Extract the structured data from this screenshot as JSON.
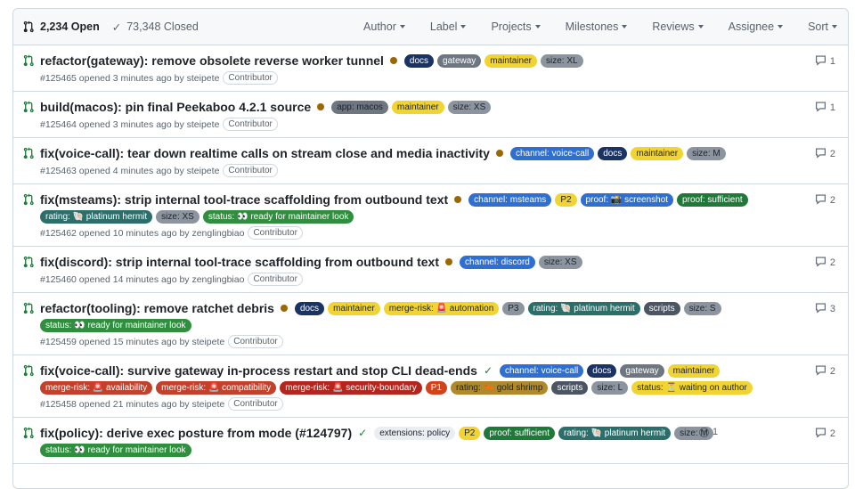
{
  "header": {
    "open_count": "2,234 Open",
    "closed_count": "73,348 Closed",
    "filters": [
      "Author",
      "Label",
      "Projects",
      "Milestones",
      "Reviews",
      "Assignee",
      "Sort"
    ]
  },
  "colors": {
    "pr_open": "#1a7f37",
    "pending_dot": "#9a6700"
  },
  "pulls": [
    {
      "title": "refactor(gateway): remove obsolete reverse worker tunnel",
      "status": "pending",
      "labels": [
        {
          "text": "docs",
          "bg": "#1a3365",
          "fg": "#ffffff"
        },
        {
          "text": "gateway",
          "bg": "#6e7781",
          "fg": "#ffffff"
        },
        {
          "text": "maintainer",
          "bg": "#f1d431",
          "fg": "#1f2328"
        },
        {
          "text": "size: XL",
          "bg": "#8c959f",
          "fg": "#1f2328"
        }
      ],
      "meta": "#125465 opened 3 minutes ago by steipete",
      "association": "Contributor",
      "comments": "1"
    },
    {
      "title": "build(macos): pin final Peekaboo 4.2.1 source",
      "status": "pending",
      "labels": [
        {
          "text": "app: macos",
          "bg": "#6e7781",
          "fg": "#1f2328"
        },
        {
          "text": "maintainer",
          "bg": "#f1d431",
          "fg": "#1f2328"
        },
        {
          "text": "size: XS",
          "bg": "#8c959f",
          "fg": "#1f2328"
        }
      ],
      "meta": "#125464 opened 3 minutes ago by steipete",
      "association": "Contributor",
      "comments": "1"
    },
    {
      "title": "fix(voice-call): tear down realtime calls on stream close and media inactivity",
      "status": "pending",
      "labels": [
        {
          "text": "channel: voice-call",
          "bg": "#2e6fd1",
          "fg": "#ffffff"
        },
        {
          "text": "docs",
          "bg": "#1a3365",
          "fg": "#ffffff"
        },
        {
          "text": "maintainer",
          "bg": "#f1d431",
          "fg": "#1f2328"
        },
        {
          "text": "size: M",
          "bg": "#8c959f",
          "fg": "#1f2328"
        }
      ],
      "meta": "#125463 opened 4 minutes ago by steipete",
      "association": "Contributor",
      "comments": "2"
    },
    {
      "title": "fix(msteams): strip internal tool-trace scaffolding from outbound text",
      "status": "pending",
      "labels": [
        {
          "text": "channel: msteams",
          "bg": "#2e6fd1",
          "fg": "#ffffff"
        },
        {
          "text": "P2",
          "bg": "#f1d431",
          "fg": "#1f2328"
        },
        {
          "text": "proof: 📸 screenshot",
          "bg": "#2e6fd1",
          "fg": "#ffffff"
        },
        {
          "text": "proof: sufficient",
          "bg": "#1f7a3a",
          "fg": "#ffffff"
        },
        {
          "text": "rating: 🐚 platinum hermit",
          "bg": "#2c6e6a",
          "fg": "#ffffff"
        },
        {
          "text": "size: XS",
          "bg": "#8c959f",
          "fg": "#1f2328"
        },
        {
          "text": "status: 👀 ready for maintainer look",
          "bg": "#2f8f3e",
          "fg": "#ffffff"
        }
      ],
      "meta": "#125462 opened 10 minutes ago by zenglingbiao",
      "association": "Contributor",
      "comments": "2"
    },
    {
      "title": "fix(discord): strip internal tool-trace scaffolding from outbound text",
      "status": "pending",
      "labels": [
        {
          "text": "channel: discord",
          "bg": "#2e6fd1",
          "fg": "#ffffff"
        },
        {
          "text": "size: XS",
          "bg": "#8c959f",
          "fg": "#1f2328"
        }
      ],
      "meta": "#125460 opened 14 minutes ago by zenglingbiao",
      "association": "Contributor",
      "comments": "2"
    },
    {
      "title": "refactor(tooling): remove ratchet debris",
      "status": "pending",
      "labels": [
        {
          "text": "docs",
          "bg": "#1a3365",
          "fg": "#ffffff"
        },
        {
          "text": "maintainer",
          "bg": "#f1d431",
          "fg": "#1f2328"
        },
        {
          "text": "merge-risk: 🚨 automation",
          "bg": "#f1d431",
          "fg": "#1f2328"
        },
        {
          "text": "P3",
          "bg": "#8c959f",
          "fg": "#1f2328"
        },
        {
          "text": "rating: 🐚 platinum hermit",
          "bg": "#2c6e6a",
          "fg": "#ffffff"
        },
        {
          "text": "scripts",
          "bg": "#4b5563",
          "fg": "#ffffff"
        },
        {
          "text": "size: S",
          "bg": "#8c959f",
          "fg": "#1f2328"
        },
        {
          "text": "status: 👀 ready for maintainer look",
          "bg": "#2f8f3e",
          "fg": "#ffffff"
        }
      ],
      "meta": "#125459 opened 15 minutes ago by steipete",
      "association": "Contributor",
      "comments": "3"
    },
    {
      "title": "fix(voice-call): survive gateway in-process restart and stop CLI dead-ends",
      "status": "success",
      "labels": [
        {
          "text": "channel: voice-call",
          "bg": "#2e6fd1",
          "fg": "#ffffff"
        },
        {
          "text": "docs",
          "bg": "#1a3365",
          "fg": "#ffffff"
        },
        {
          "text": "gateway",
          "bg": "#6e7781",
          "fg": "#ffffff"
        },
        {
          "text": "maintainer",
          "bg": "#f1d431",
          "fg": "#1f2328"
        },
        {
          "text": "merge-risk: 🚨 availability",
          "bg": "#c2412b",
          "fg": "#ffffff"
        },
        {
          "text": "merge-risk: 🚨 compatibility",
          "bg": "#c2412b",
          "fg": "#ffffff"
        },
        {
          "text": "merge-risk: 🚨 security-boundary",
          "bg": "#b3261e",
          "fg": "#ffffff"
        },
        {
          "text": "P1",
          "bg": "#d1431a",
          "fg": "#ffffff"
        },
        {
          "text": "rating: 🦐 gold shrimp",
          "bg": "#b08a2a",
          "fg": "#1f2328"
        },
        {
          "text": "scripts",
          "bg": "#4b5563",
          "fg": "#ffffff"
        },
        {
          "text": "size: L",
          "bg": "#8c959f",
          "fg": "#1f2328"
        },
        {
          "text": "status: ⏳ waiting on author",
          "bg": "#f1d431",
          "fg": "#1f2328"
        }
      ],
      "meta": "#125458 opened 21 minutes ago by steipete",
      "association": "Contributor",
      "comments": "2"
    },
    {
      "title": "fix(policy): derive exec posture from mode (#124797)",
      "status": "success",
      "labels": [
        {
          "text": "extensions: policy",
          "bg": "#eaeef2",
          "fg": "#1f2328"
        },
        {
          "text": "P2",
          "bg": "#f1d431",
          "fg": "#1f2328"
        },
        {
          "text": "proof: sufficient",
          "bg": "#1f7a3a",
          "fg": "#ffffff"
        },
        {
          "text": "rating: 🐚 platinum hermit",
          "bg": "#2c6e6a",
          "fg": "#ffffff"
        },
        {
          "text": "size: M",
          "bg": "#8c959f",
          "fg": "#1f2328"
        },
        {
          "text": "status: 👀 ready for maintainer look",
          "bg": "#2f8f3e",
          "fg": "#ffffff"
        }
      ],
      "meta": "",
      "association": "",
      "linked_issues": "1",
      "comments": "2"
    }
  ]
}
